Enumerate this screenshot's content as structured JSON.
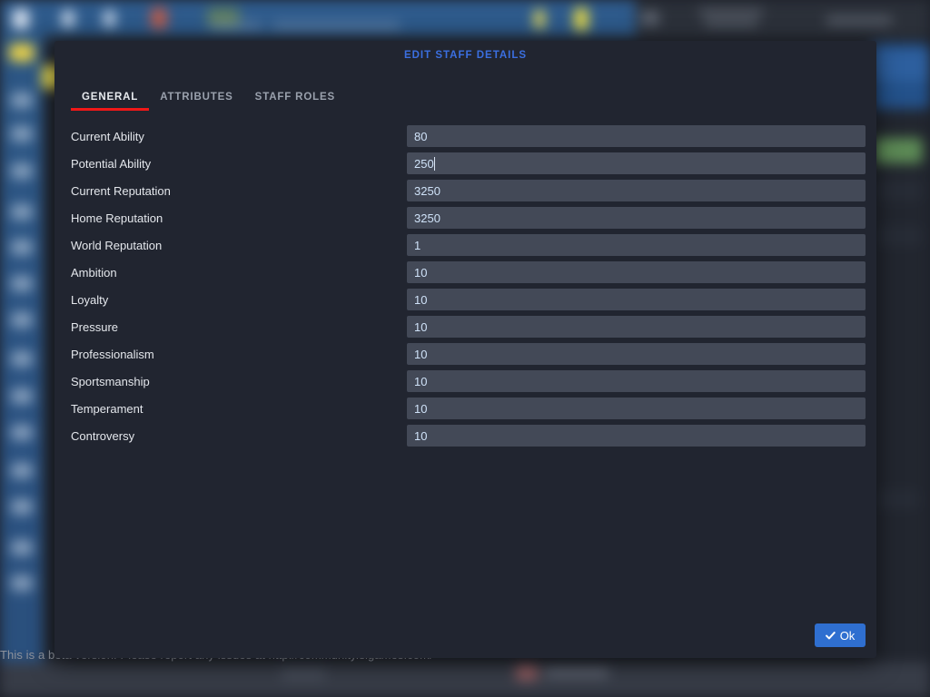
{
  "background": {
    "beta_notice": "This is a beta version. Please report any issues at http://community.sigames.com/"
  },
  "modal": {
    "title": "EDIT STAFF DETAILS",
    "tabs": [
      {
        "label": "GENERAL",
        "active": true
      },
      {
        "label": "ATTRIBUTES",
        "active": false
      },
      {
        "label": "STAFF ROLES",
        "active": false
      }
    ],
    "fields": [
      {
        "label": "Current Ability",
        "value": "80",
        "focused": false
      },
      {
        "label": "Potential Ability",
        "value": "250",
        "focused": true
      },
      {
        "label": "Current Reputation",
        "value": "3250",
        "focused": false
      },
      {
        "label": "Home Reputation",
        "value": "3250",
        "focused": false
      },
      {
        "label": "World Reputation",
        "value": "1",
        "focused": false
      },
      {
        "label": "Ambition",
        "value": "10",
        "focused": false
      },
      {
        "label": "Loyalty",
        "value": "10",
        "focused": false
      },
      {
        "label": "Pressure",
        "value": "10",
        "focused": false
      },
      {
        "label": "Professionalism",
        "value": "10",
        "focused": false
      },
      {
        "label": "Sportsmanship",
        "value": "10",
        "focused": false
      },
      {
        "label": "Temperament",
        "value": "10",
        "focused": false
      },
      {
        "label": "Controversy",
        "value": "10",
        "focused": false
      }
    ],
    "ok_button": {
      "label": "Ok",
      "icon": "check-icon"
    }
  },
  "colors": {
    "title_blue": "#3b6fe0",
    "tab_underline_red": "#f01818",
    "ok_button_blue": "#2f6fd0",
    "modal_bg": "#212530",
    "input_bg": "#434957",
    "sidebar_blue": "#2a5180"
  }
}
